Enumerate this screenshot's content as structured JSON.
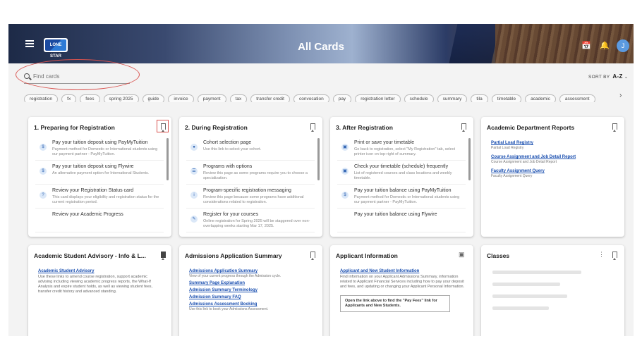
{
  "header": {
    "title": "All Cards",
    "logo_text": "LONE STAR",
    "avatar_initial": "J",
    "icons": [
      "menu-icon",
      "calendar-check-icon",
      "bell-icon"
    ]
  },
  "search": {
    "placeholder": "Find cards"
  },
  "sort": {
    "label": "SORT BY",
    "value": "A-Z"
  },
  "chips": [
    "registration",
    "fx",
    "fees",
    "spring 2025",
    "guide",
    "invoice",
    "payment",
    "tax",
    "transfer credit",
    "convocation",
    "pay",
    "registration letter",
    "schedule",
    "summary",
    "tila",
    "timetable",
    "academic",
    "assessment"
  ],
  "cards": {
    "prep": {
      "title": "1. Preparing for Registration",
      "items": [
        {
          "title": "Pay your tuition deposit using PayMyTuition",
          "desc": "Payment method for Domestic or International students using our payment partner - PayMyTuition."
        },
        {
          "title": "Pay your tuition deposit using Flywire",
          "desc": "An alternative payment option for International Students."
        },
        {
          "title": "Review your Registration Status card",
          "desc": "This card displays your eligibility and registration status for the current registration period."
        },
        {
          "title": "Review your Academic Progress",
          "desc": ""
        }
      ]
    },
    "during": {
      "title": "2. During Registration",
      "items": [
        {
          "title": "Cohort selection page",
          "desc": "Use this link to select your cohort."
        },
        {
          "title": "Programs with options",
          "desc": "Review this page as some programs require you to choose a specialization."
        },
        {
          "title": "Program-specific registration messaging",
          "desc": "Review this page because some programs have additional considerations related to registration."
        },
        {
          "title": "Register for your courses",
          "desc": "Online registration for Spring 2025 will be staggered over non-overlapping weeks starting Mar 17, 2025."
        }
      ]
    },
    "after": {
      "title": "3. After Registration",
      "items": [
        {
          "title": "Print or save your timetable",
          "desc": "Go back to registration, select \"My Registration\" tab, select printer icon on top-right of summary."
        },
        {
          "title": "Check your timetable (schedule) frequently",
          "desc": "List of registered courses and class locations and weekly timetable."
        },
        {
          "title": "Pay your tuition balance using PayMyTuition",
          "desc": "Payment method for Domestic or International students using our payment partner - PayMyTuition."
        },
        {
          "title": "Pay your tuition balance using Flywire",
          "desc": ""
        }
      ]
    },
    "dept": {
      "title": "Academic Department Reports",
      "links": [
        {
          "label": "Partial Load Registry",
          "desc": "Partial Load Registry"
        },
        {
          "label": "Course Assignment and Job Detail Report",
          "desc": "Course Assignment and Job Detail Report"
        },
        {
          "label": "Faculty Assignment Query",
          "desc": "Faculty Assignment Query"
        }
      ]
    },
    "advisory": {
      "title": "Academic Student Advisory - Info & L...",
      "link": "Academic Student Advisory",
      "desc": "Use these links to amend course registration, support academic advising including viewing academic progress reports, the What-If Analysis and expire student holds, as well as viewing student fees, transfer credit history and advanced standing."
    },
    "admissions": {
      "title": "Admissions Application Summary",
      "links": [
        {
          "label": "Admissions Application Summary",
          "desc": "View of your current progress through the Admission cycle."
        },
        {
          "label": "Summary Page Explanation",
          "desc": ""
        },
        {
          "label": "Admission Summary Terminology",
          "desc": ""
        },
        {
          "label": "Admission Summary FAQ",
          "desc": ""
        },
        {
          "label": "Admissions Assessment Booking",
          "desc": "Use this link to book your Admissions Assessment."
        }
      ]
    },
    "applicant": {
      "title": "Applicant Information",
      "link": "Applicant and New Student Information",
      "desc": "Find information on your Applicant Admissions Summary, information related to Applicant Financial Services including how to pay your deposit and fees, and updating or changing your Applicant Personal Information.",
      "note": "Open the link above to find the \"Pay Fees\" link for Applicants and New Students."
    },
    "classes": {
      "title": "Classes"
    }
  }
}
